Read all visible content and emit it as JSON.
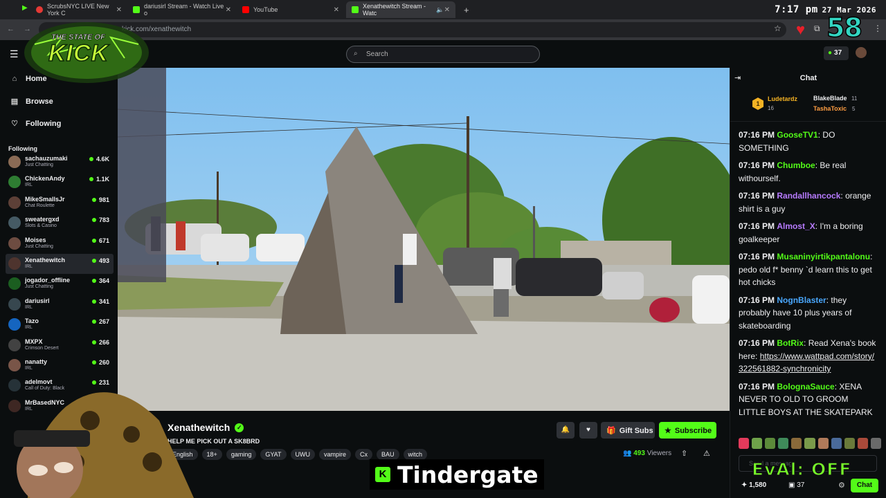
{
  "browser": {
    "tabs": [
      {
        "label": "ScrubsNYC LIVE New York C",
        "fav_color": "#e53935",
        "active": false
      },
      {
        "label": "dariusirl Stream - Watch Live o",
        "fav_color": "#53fc18",
        "active": false
      },
      {
        "label": "YouTube",
        "fav_color": "#ff0000",
        "active": false
      },
      {
        "label": "Xenathewitch Stream - Watc",
        "fav_color": "#53fc18",
        "active": true
      }
    ],
    "new_tab": "+",
    "address_fragment": "kick.com/xenathewitch"
  },
  "clock": {
    "time": "7:17 pm",
    "date": "27 Mar 2026"
  },
  "overlays": {
    "counter": "58",
    "eval_banner": "EvAl: OFF",
    "caption": "Tindergate",
    "logo_line1": "THE STATE OF",
    "logo_line2": "KICK"
  },
  "header": {
    "search_placeholder": "Search",
    "coins": "37"
  },
  "sidebar": {
    "nav": [
      {
        "label": "Home",
        "icon": "home-icon"
      },
      {
        "label": "Browse",
        "icon": "browse-icon"
      },
      {
        "label": "Following",
        "icon": "heart-icon"
      }
    ],
    "following_heading": "Following",
    "following": [
      {
        "name": "sachauzumaki",
        "category": "Just Chatting",
        "viewers": "4.6K",
        "color": "#8a6b55"
      },
      {
        "name": "ChickenAndy",
        "category": "IRL",
        "viewers": "1.1K",
        "color": "#2e7d32"
      },
      {
        "name": "MikeSmallsJr",
        "category": "Chat Roulette",
        "viewers": "981",
        "color": "#5d4037"
      },
      {
        "name": "sweatergxd",
        "category": "Slots & Casino",
        "viewers": "783",
        "color": "#455a64"
      },
      {
        "name": "Moises",
        "category": "Just Chatting",
        "viewers": "671",
        "color": "#6d4c41"
      },
      {
        "name": "Xenathewitch",
        "category": "IRL",
        "viewers": "493",
        "color": "#4e342e"
      },
      {
        "name": "jogador_offline",
        "category": "Just Chatting",
        "viewers": "364",
        "color": "#1b5e20"
      },
      {
        "name": "dariusirl",
        "category": "IRL",
        "viewers": "341",
        "color": "#37474f"
      },
      {
        "name": "Tazo",
        "category": "IRL",
        "viewers": "267",
        "color": "#1565c0"
      },
      {
        "name": "MXPX",
        "category": "Crimson Desert",
        "viewers": "266",
        "color": "#424242"
      },
      {
        "name": "nanatty",
        "category": "IRL",
        "viewers": "260",
        "color": "#795548"
      },
      {
        "name": "adelmovt",
        "category": "Call of Duty: Black",
        "viewers": "231",
        "color": "#263238"
      },
      {
        "name": "MrBasedNYC",
        "category": "IRL",
        "viewers": "",
        "color": "#3e2723"
      }
    ]
  },
  "stream": {
    "streamer": "Xenathewitch",
    "title": "HELP ME PICK OUT A SK8BRD",
    "tags": [
      "English",
      "18+",
      "gaming",
      "GYAT",
      "UWU",
      "vampire",
      "Cx",
      "BAU",
      "witch"
    ],
    "gift_label": "Gift Subs",
    "subscribe_label": "Subscribe",
    "viewers_count": "493",
    "viewers_label": "Viewers"
  },
  "chat": {
    "title": "Chat",
    "leaderboard": [
      {
        "name": "Ludetardz",
        "count": "16",
        "color": "#f5b324"
      },
      {
        "name": "BlakeBlade",
        "count": "11",
        "color": "#efeff1"
      },
      {
        "name": "TashaToxic",
        "count": "5",
        "color": "#ff9e42"
      }
    ],
    "rank_badge": "1",
    "messages": [
      {
        "time": "07:16 PM",
        "user": "GooseTV1",
        "color": "#53fc18",
        "text": "DO SOMETHING"
      },
      {
        "time": "07:16 PM",
        "user": "Chumboe",
        "color": "#53fc18",
        "text": "Be real withourself."
      },
      {
        "time": "07:16 PM",
        "user": "Randallhancock",
        "color": "#b77bff",
        "text": "orange shirt is a guy"
      },
      {
        "time": "07:16 PM",
        "user": "Almost_X",
        "color": "#b77bff",
        "text": "I'm a boring goalkeeper"
      },
      {
        "time": "07:16 PM",
        "user": "Musaninyirtikpantalonu",
        "color": "#53fc18",
        "text": "pedo old f* benny `d learn this to get hot chicks"
      },
      {
        "time": "07:16 PM",
        "user": "NognBlaster",
        "color": "#4aa8ff",
        "text": "they probably have 10 plus years of skateboarding"
      },
      {
        "time": "07:16 PM",
        "user": "BotRix",
        "color": "#53fc18",
        "text": "Read Xena's book here:",
        "link": "https://www.wattpad.com/story/322561882-synchronicity"
      },
      {
        "time": "07:16 PM",
        "user": "BolognaSauce",
        "color": "#53fc18",
        "text": "XENA NEVER TO OLD TO GROOM LITTLE BOYS AT THE SKATEPARK"
      }
    ],
    "input_placeholder": "Send a message",
    "points": "1,580",
    "gift_count": "37",
    "chat_button": "Chat"
  }
}
